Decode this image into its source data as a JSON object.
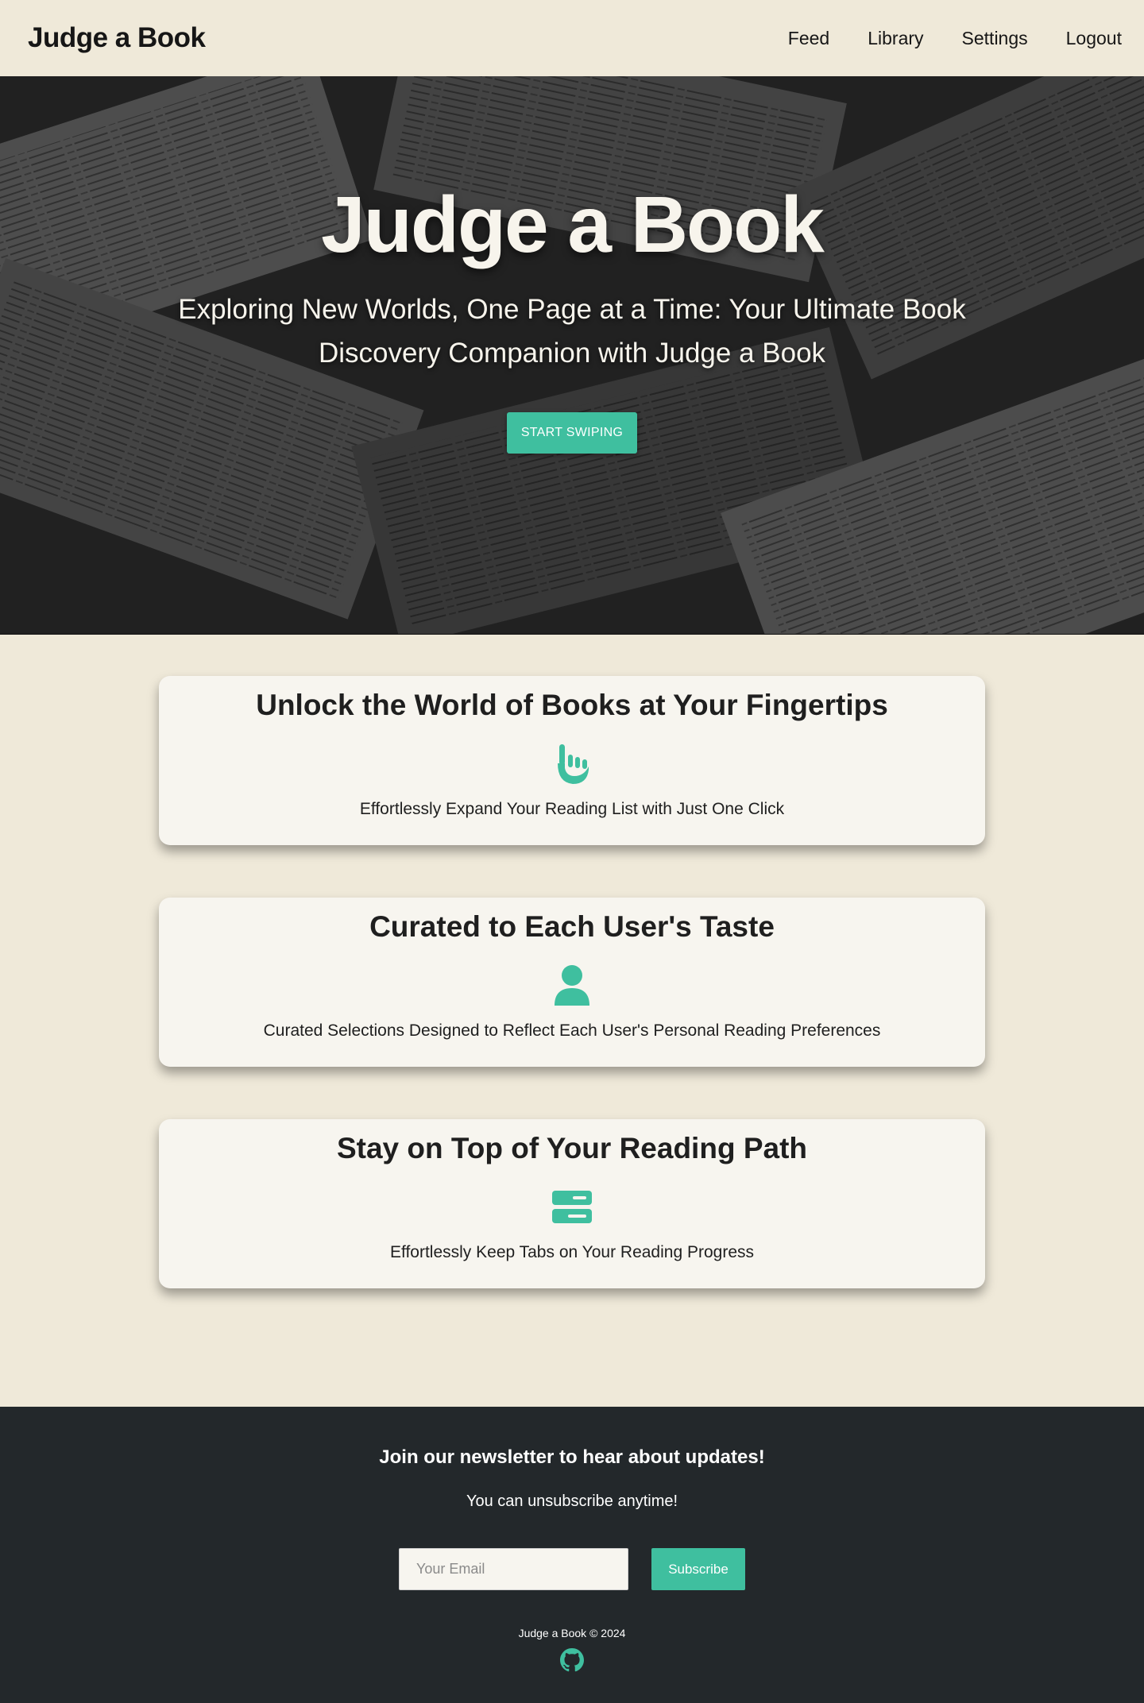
{
  "nav": {
    "brand": "Judge a Book",
    "links": [
      "Feed",
      "Library",
      "Settings",
      "Logout"
    ]
  },
  "hero": {
    "title": "Judge a Book",
    "subtitle": "Exploring New Worlds, One Page at a Time: Your Ultimate Book Discovery Companion with Judge a Book",
    "cta": "START SWIPING"
  },
  "features": [
    {
      "title": "Unlock the World of Books at Your Fingertips",
      "icon": "hand-pointer-icon",
      "text": "Effortlessly Expand Your Reading List with Just One Click"
    },
    {
      "title": "Curated to Each User's Taste",
      "icon": "user-icon",
      "text": "Curated Selections Designed to Reflect Each User's Personal Reading Preferences"
    },
    {
      "title": "Stay on Top of Your Reading Path",
      "icon": "server-icon",
      "text": "Effortlessly Keep Tabs on Your Reading Progress"
    }
  ],
  "footer": {
    "heading": "Join our newsletter to hear about updates!",
    "subheading": "You can unsubscribe anytime!",
    "email_placeholder": "Your Email",
    "subscribe_label": "Subscribe",
    "copyright": "Judge a Book © 2024",
    "social_icon": "github-icon"
  },
  "colors": {
    "accent": "#3fbf9f",
    "background": "#efe9d9",
    "card": "#f7f5ef",
    "footer": "#23282b"
  }
}
